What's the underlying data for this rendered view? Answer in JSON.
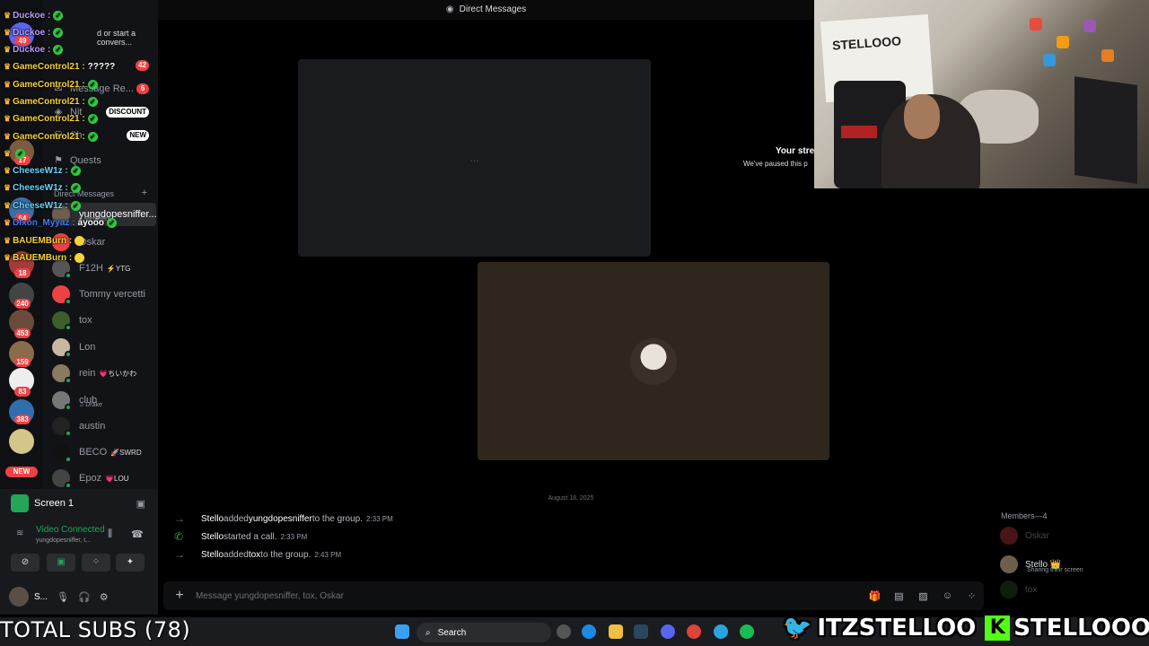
{
  "topbar": {
    "title": "Direct Messages"
  },
  "chat_overlay": [
    {
      "user": "Duckoe :",
      "color": "#b89cff",
      "msg": "",
      "chk": true
    },
    {
      "user": "Duckoe :",
      "color": "#b89cff",
      "msg": "",
      "chk": true
    },
    {
      "user": "Duckoe :",
      "color": "#b89cff",
      "msg": "",
      "chk": true
    },
    {
      "user": "GameControl21 :",
      "color": "#f5d23a",
      "msg": "?????",
      "chk": false
    },
    {
      "user": "GameControl21 :",
      "color": "#f5d23a",
      "msg": "",
      "chk": true
    },
    {
      "user": "GameControl21 :",
      "color": "#f5d23a",
      "msg": "",
      "chk": true
    },
    {
      "user": "GameControl21 :",
      "color": "#f5d23a",
      "msg": "",
      "chk": true
    },
    {
      "user": "GameControl21 :",
      "color": "#f5d23a",
      "msg": "",
      "chk": true
    },
    {
      "user": "",
      "color": "#ffffff",
      "msg": "",
      "chk": true
    },
    {
      "user": "CheeseW1z :",
      "color": "#6bd4ff",
      "msg": "",
      "chk": true
    },
    {
      "user": "CheeseW1z :",
      "color": "#6bd4ff",
      "msg": "",
      "chk": true
    },
    {
      "user": "CheeseW1z :",
      "color": "#6bd4ff",
      "msg": "",
      "chk": true
    },
    {
      "user": "Dixon_Myyaz :",
      "color": "#3d7bff",
      "msg": "ayooo",
      "chk": true
    },
    {
      "user": "BAUEMBurn :",
      "color": "#f5d23a",
      "msg": "",
      "chk": false,
      "smile": true
    },
    {
      "user": "BAUEMBurn :",
      "color": "#f5d23a",
      "msg": "",
      "chk": false,
      "smile": true
    }
  ],
  "sidebar": {
    "conversation_hint": "d or start a convers...",
    "nav": [
      {
        "label": "Message Re...",
        "badge": "6",
        "badge_color": "#ed4245"
      },
      {
        "label": "Nit",
        "badge": "DISCOUNT",
        "badge_color": "#ffffff"
      },
      {
        "label": "Sh",
        "badge": "NEW",
        "badge_color": "#ffffff"
      },
      {
        "label": "Quests",
        "badge": "",
        "badge_color": ""
      }
    ],
    "friends_badge": "42",
    "section_label": "Direct Messages",
    "dms": [
      {
        "name": "yungdopesniffer...",
        "sub": "4 Members",
        "tag": "",
        "color": "#6d5e4e",
        "online": false
      },
      {
        "name": "Oskar",
        "sub": "",
        "tag": "",
        "color": "#ed4245",
        "online": false
      },
      {
        "name": "F12H",
        "sub": "",
        "tag": "⚡YTG",
        "color": "#555",
        "online": true
      },
      {
        "name": "Tommy vercetti",
        "sub": "",
        "tag": "",
        "color": "#ed4245",
        "online": true
      },
      {
        "name": "tox",
        "sub": "",
        "tag": "",
        "color": "#3b5e2b",
        "online": true
      },
      {
        "name": "Lon",
        "sub": "",
        "tag": "",
        "color": "#c9b8a0",
        "online": true
      },
      {
        "name": "rein",
        "sub": "",
        "tag": "💗ちいかわ",
        "color": "#8a7a60",
        "online": true
      },
      {
        "name": "club",
        "sub": "♫ Drake",
        "tag": "",
        "color": "#777",
        "online": true
      },
      {
        "name": "austin",
        "sub": "",
        "tag": "",
        "color": "#222",
        "online": true
      },
      {
        "name": "BECO",
        "sub": "",
        "tag": "🚀SWRD",
        "color": "#111",
        "online": true
      },
      {
        "name": "Epoz",
        "sub": "",
        "tag": "💗LOU",
        "color": "#444",
        "online": true
      }
    ]
  },
  "rail": {
    "badges": [
      {
        "top": "49"
      },
      {
        "top": "17"
      },
      {
        "top": "64"
      },
      {
        "top": "18"
      },
      {
        "top": "240"
      },
      {
        "top": "453"
      },
      {
        "top": "159"
      },
      {
        "top": "83"
      },
      {
        "top": "383"
      }
    ],
    "new_label": "NEW"
  },
  "voice": {
    "screen_label": "Screen 1",
    "status": "Video Connected",
    "status_sub": "yungdopesniffer, t...",
    "user_short": "S..."
  },
  "call": {
    "paused_title": "Your strea",
    "paused_sub": "We've paused this p",
    "loading": "..."
  },
  "webcam": {
    "board_text": "STELLOOO"
  },
  "messages": {
    "date_divider": "August 18, 2025",
    "items": [
      {
        "actor": "Stello",
        "text_a": " added ",
        "target": "yungdopesniffer",
        "text_b": " to the group.",
        "time": "2:33 PM",
        "icon": "→"
      },
      {
        "actor": "Stello",
        "text_a": " started a call.",
        "target": "",
        "text_b": "",
        "time": "2:33 PM",
        "icon": "✆"
      },
      {
        "actor": "Stello",
        "text_a": " added ",
        "target": "tox",
        "text_b": " to the group.",
        "time": "2:43 PM",
        "icon": "→"
      }
    ],
    "composer_placeholder": "Message yungdopesniffer, tox, Oskar"
  },
  "members": {
    "header": "Members—4",
    "list": [
      {
        "name": "Oskar",
        "sub": "",
        "dim": true,
        "color": "#ed4245"
      },
      {
        "name": "Stello 👑",
        "sub": "Sharing their screen",
        "dim": false,
        "color": "#6d5e4e"
      },
      {
        "name": "tox",
        "sub": "",
        "dim": true,
        "color": "#3b5e2b"
      }
    ]
  },
  "taskbar": {
    "search_label": "Search"
  },
  "overlay": {
    "total_subs": "TOTAL SUBS (78)",
    "twitter_handle": "ITZSTELLOO",
    "kick_handle": "STELLOOO"
  },
  "colors": {
    "accent_green": "#23a55a",
    "danger": "#ed4245",
    "kick_green": "#53fc18",
    "twitter_blue": "#1da1f2"
  }
}
